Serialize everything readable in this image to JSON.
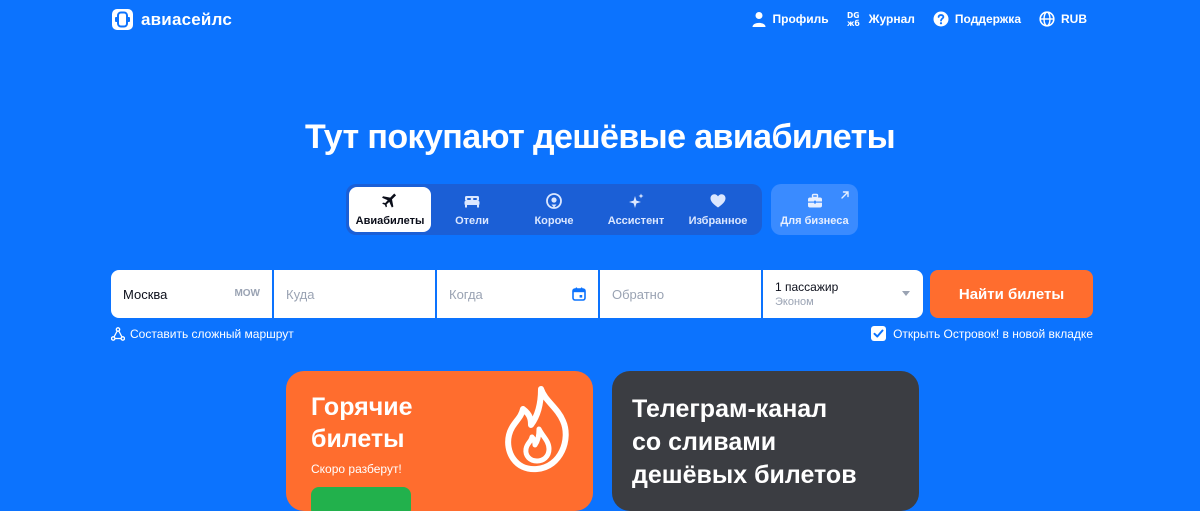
{
  "brand": {
    "name": "авиасейлс"
  },
  "nav": {
    "profile": "Профиль",
    "journal": "Журнал",
    "support": "Поддержка",
    "currency": "RUB"
  },
  "hero": {
    "title": "Тут покупают дешёвые авиабилеты"
  },
  "tabs": [
    {
      "label": "Авиабилеты",
      "icon": "plane-icon",
      "active": true
    },
    {
      "label": "Отели",
      "icon": "bed-icon",
      "active": false
    },
    {
      "label": "Короче",
      "icon": "location-pin-icon",
      "active": false
    },
    {
      "label": "Ассистент",
      "icon": "sparkles-icon",
      "active": false
    },
    {
      "label": "Избранное",
      "icon": "heart-icon",
      "active": false
    }
  ],
  "business_tab": {
    "label": "Для бизнеса",
    "icon": "briefcase-icon"
  },
  "search": {
    "origin": {
      "value": "Москва",
      "iata": "MOW"
    },
    "destination": {
      "placeholder": "Куда"
    },
    "depart": {
      "placeholder": "Когда"
    },
    "return": {
      "placeholder": "Обратно"
    },
    "passengers": {
      "count": "1 пассажир",
      "class": "Эконом"
    },
    "submit_label": "Найти билеты"
  },
  "route_link": "Составить сложный маршрут",
  "ostrovok": {
    "label": "Открыть Островок! в новой вкладке",
    "checked": true
  },
  "promos": {
    "hot": {
      "title": "Горячие\nбилеты",
      "subtitle": "Скоро разберут!"
    },
    "telegram": {
      "title": "Телеграм-канал\nсо сливами\nдешёвых билетов"
    }
  },
  "colors": {
    "background": "#0c73fe",
    "accent_orange": "#ff6d2e",
    "tabs_bg": "#1b5fd6",
    "business_bg": "#3a8bff",
    "promo_dark": "#3b3d42"
  }
}
